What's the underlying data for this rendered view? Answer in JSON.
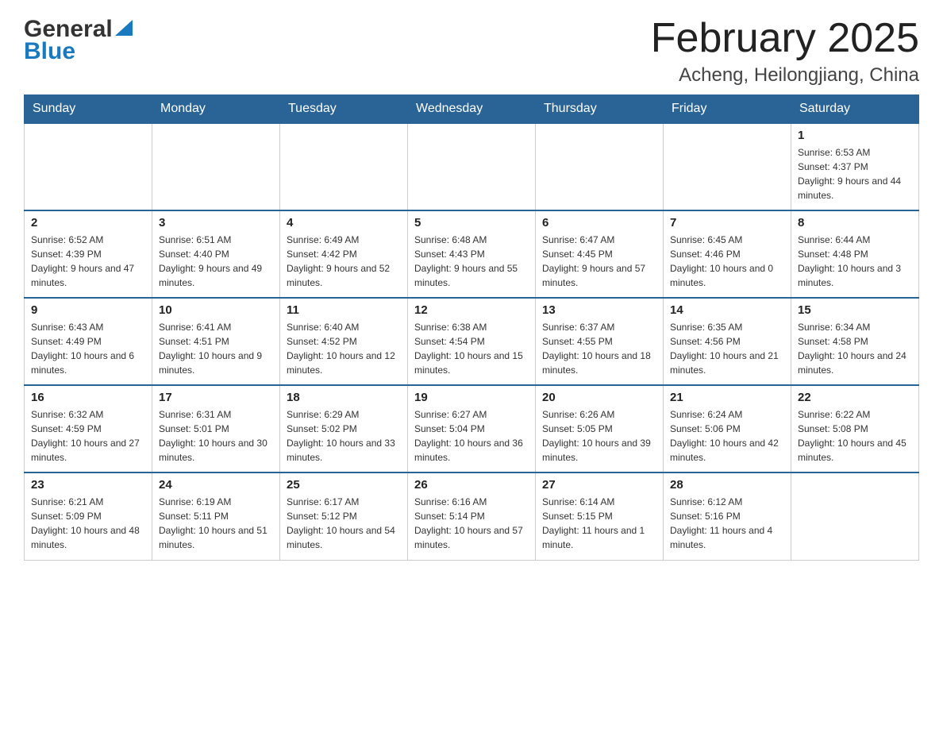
{
  "header": {
    "logo_general": "General",
    "logo_blue": "Blue",
    "month_title": "February 2025",
    "location": "Acheng, Heilongjiang, China"
  },
  "weekdays": [
    "Sunday",
    "Monday",
    "Tuesday",
    "Wednesday",
    "Thursday",
    "Friday",
    "Saturday"
  ],
  "weeks": [
    [
      {
        "day": "",
        "info": ""
      },
      {
        "day": "",
        "info": ""
      },
      {
        "day": "",
        "info": ""
      },
      {
        "day": "",
        "info": ""
      },
      {
        "day": "",
        "info": ""
      },
      {
        "day": "",
        "info": ""
      },
      {
        "day": "1",
        "info": "Sunrise: 6:53 AM\nSunset: 4:37 PM\nDaylight: 9 hours and 44 minutes."
      }
    ],
    [
      {
        "day": "2",
        "info": "Sunrise: 6:52 AM\nSunset: 4:39 PM\nDaylight: 9 hours and 47 minutes."
      },
      {
        "day": "3",
        "info": "Sunrise: 6:51 AM\nSunset: 4:40 PM\nDaylight: 9 hours and 49 minutes."
      },
      {
        "day": "4",
        "info": "Sunrise: 6:49 AM\nSunset: 4:42 PM\nDaylight: 9 hours and 52 minutes."
      },
      {
        "day": "5",
        "info": "Sunrise: 6:48 AM\nSunset: 4:43 PM\nDaylight: 9 hours and 55 minutes."
      },
      {
        "day": "6",
        "info": "Sunrise: 6:47 AM\nSunset: 4:45 PM\nDaylight: 9 hours and 57 minutes."
      },
      {
        "day": "7",
        "info": "Sunrise: 6:45 AM\nSunset: 4:46 PM\nDaylight: 10 hours and 0 minutes."
      },
      {
        "day": "8",
        "info": "Sunrise: 6:44 AM\nSunset: 4:48 PM\nDaylight: 10 hours and 3 minutes."
      }
    ],
    [
      {
        "day": "9",
        "info": "Sunrise: 6:43 AM\nSunset: 4:49 PM\nDaylight: 10 hours and 6 minutes."
      },
      {
        "day": "10",
        "info": "Sunrise: 6:41 AM\nSunset: 4:51 PM\nDaylight: 10 hours and 9 minutes."
      },
      {
        "day": "11",
        "info": "Sunrise: 6:40 AM\nSunset: 4:52 PM\nDaylight: 10 hours and 12 minutes."
      },
      {
        "day": "12",
        "info": "Sunrise: 6:38 AM\nSunset: 4:54 PM\nDaylight: 10 hours and 15 minutes."
      },
      {
        "day": "13",
        "info": "Sunrise: 6:37 AM\nSunset: 4:55 PM\nDaylight: 10 hours and 18 minutes."
      },
      {
        "day": "14",
        "info": "Sunrise: 6:35 AM\nSunset: 4:56 PM\nDaylight: 10 hours and 21 minutes."
      },
      {
        "day": "15",
        "info": "Sunrise: 6:34 AM\nSunset: 4:58 PM\nDaylight: 10 hours and 24 minutes."
      }
    ],
    [
      {
        "day": "16",
        "info": "Sunrise: 6:32 AM\nSunset: 4:59 PM\nDaylight: 10 hours and 27 minutes."
      },
      {
        "day": "17",
        "info": "Sunrise: 6:31 AM\nSunset: 5:01 PM\nDaylight: 10 hours and 30 minutes."
      },
      {
        "day": "18",
        "info": "Sunrise: 6:29 AM\nSunset: 5:02 PM\nDaylight: 10 hours and 33 minutes."
      },
      {
        "day": "19",
        "info": "Sunrise: 6:27 AM\nSunset: 5:04 PM\nDaylight: 10 hours and 36 minutes."
      },
      {
        "day": "20",
        "info": "Sunrise: 6:26 AM\nSunset: 5:05 PM\nDaylight: 10 hours and 39 minutes."
      },
      {
        "day": "21",
        "info": "Sunrise: 6:24 AM\nSunset: 5:06 PM\nDaylight: 10 hours and 42 minutes."
      },
      {
        "day": "22",
        "info": "Sunrise: 6:22 AM\nSunset: 5:08 PM\nDaylight: 10 hours and 45 minutes."
      }
    ],
    [
      {
        "day": "23",
        "info": "Sunrise: 6:21 AM\nSunset: 5:09 PM\nDaylight: 10 hours and 48 minutes."
      },
      {
        "day": "24",
        "info": "Sunrise: 6:19 AM\nSunset: 5:11 PM\nDaylight: 10 hours and 51 minutes."
      },
      {
        "day": "25",
        "info": "Sunrise: 6:17 AM\nSunset: 5:12 PM\nDaylight: 10 hours and 54 minutes."
      },
      {
        "day": "26",
        "info": "Sunrise: 6:16 AM\nSunset: 5:14 PM\nDaylight: 10 hours and 57 minutes."
      },
      {
        "day": "27",
        "info": "Sunrise: 6:14 AM\nSunset: 5:15 PM\nDaylight: 11 hours and 1 minute."
      },
      {
        "day": "28",
        "info": "Sunrise: 6:12 AM\nSunset: 5:16 PM\nDaylight: 11 hours and 4 minutes."
      },
      {
        "day": "",
        "info": ""
      }
    ]
  ]
}
